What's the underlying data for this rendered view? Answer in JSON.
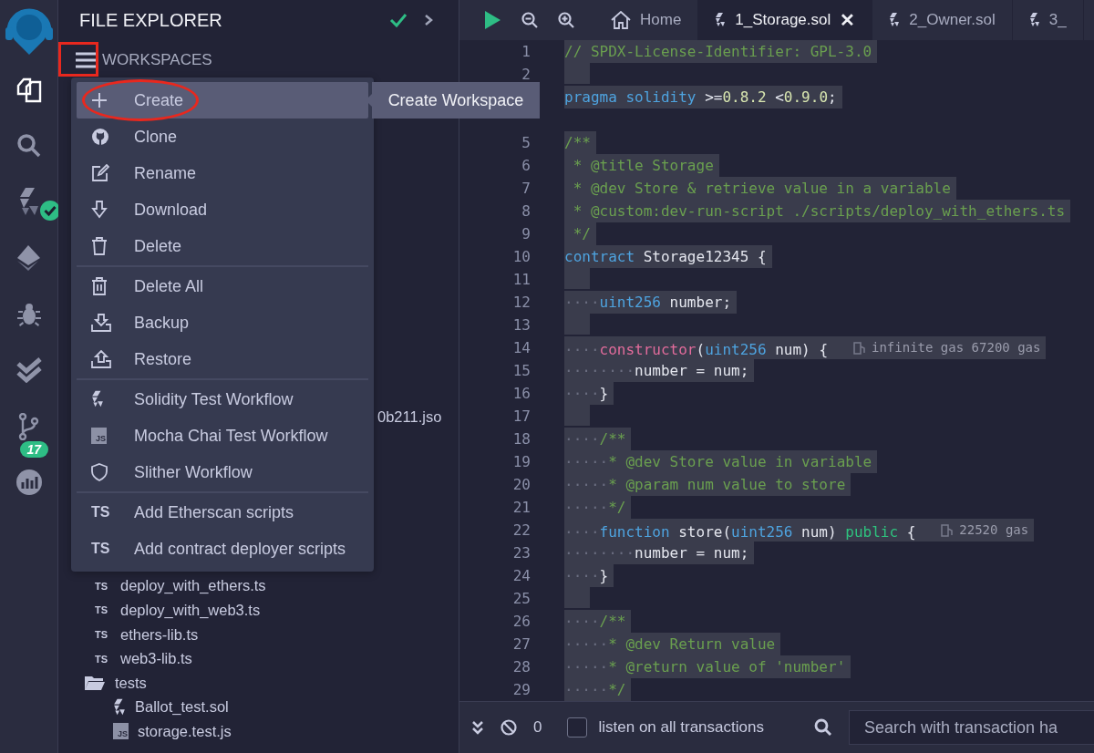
{
  "sidebar": {
    "items": [
      {
        "kind": "logo",
        "selected": false
      },
      {
        "kind": "files",
        "selected": true
      },
      {
        "kind": "search",
        "selected": false
      },
      {
        "kind": "compiler",
        "selected": false,
        "compiled": true
      },
      {
        "kind": "deploy",
        "selected": false
      },
      {
        "kind": "debug",
        "selected": false
      },
      {
        "kind": "test",
        "selected": false
      },
      {
        "kind": "git",
        "selected": false,
        "badge": "17"
      },
      {
        "kind": "analytics",
        "selected": false
      }
    ]
  },
  "explorer": {
    "title": "FILE EXPLORER",
    "section": "WORKSPACES",
    "tree": [
      {
        "name": "0b211.jso",
        "kind": "fragment"
      },
      {
        "name": "deploy_with_ethers.ts",
        "kind": "ts",
        "icon_label": "TS"
      },
      {
        "name": "deploy_with_web3.ts",
        "kind": "ts",
        "icon_label": "TS"
      },
      {
        "name": "ethers-lib.ts",
        "kind": "ts",
        "icon_label": "TS"
      },
      {
        "name": "web3-lib.ts",
        "kind": "ts",
        "icon_label": "TS"
      },
      {
        "name": "tests",
        "kind": "folder",
        "children": [
          {
            "name": "Ballot_test.sol",
            "kind": "sol"
          },
          {
            "name": "storage.test.js",
            "kind": "js",
            "icon_label": "JS"
          }
        ]
      }
    ]
  },
  "menu": {
    "groups": [
      [
        {
          "label": "Create",
          "kind": "plus",
          "selected": true
        },
        {
          "label": "Clone",
          "kind": "github",
          "selected": false
        },
        {
          "label": "Rename",
          "kind": "edit",
          "selected": false
        },
        {
          "label": "Download",
          "kind": "download",
          "selected": false
        },
        {
          "label": "Delete",
          "kind": "trash",
          "selected": false
        }
      ],
      [
        {
          "label": "Delete All",
          "kind": "trash-all",
          "selected": false
        },
        {
          "label": "Backup",
          "kind": "backup",
          "selected": false
        },
        {
          "label": "Restore",
          "kind": "restore",
          "selected": false
        }
      ],
      [
        {
          "label": "Solidity Test Workflow",
          "kind": "sol",
          "selected": false
        },
        {
          "label": "Mocha Chai Test Workflow",
          "kind": "js",
          "icon_label": "JS",
          "selected": false
        },
        {
          "label": "Slither Workflow",
          "kind": "shield",
          "selected": false
        }
      ],
      [
        {
          "label": "Add Etherscan scripts",
          "kind": "ts",
          "icon_label": "TS",
          "selected": false
        },
        {
          "label": "Add contract deployer scripts",
          "kind": "ts",
          "icon_label": "TS",
          "selected": false
        }
      ]
    ],
    "tooltip": "Create Workspace"
  },
  "editor": {
    "tabs": [
      {
        "label": "Home",
        "kind": "home",
        "selected": false
      },
      {
        "label": "1_Storage.sol",
        "kind": "sol",
        "selected": true,
        "close": "✕"
      },
      {
        "label": "2_Owner.sol",
        "kind": "sol",
        "selected": false
      },
      {
        "label": "3_",
        "kind": "sol",
        "selected": false
      }
    ],
    "lines": [
      {
        "number": "1",
        "tokens": [
          {
            "t": "// SPDX-License-Identifier: GPL-3.0",
            "kind": "comment"
          }
        ]
      },
      {
        "number": "2"
      },
      {
        "tokens": [
          {
            "t": "pragma",
            "kind": "keyword"
          },
          {
            "t": " solidity",
            "kind": "keyword"
          },
          {
            "t": " >=",
            "kind": "plain"
          },
          {
            "t": "0.8.2",
            "kind": "number"
          },
          {
            "t": " <",
            "kind": "plain"
          },
          {
            "t": "0.9.0",
            "kind": "number"
          },
          {
            "t": ";",
            "kind": "plain"
          }
        ]
      },
      {
        "kind": "blank"
      },
      {
        "number": "5",
        "tokens": [
          {
            "t": "/**",
            "kind": "comment"
          }
        ]
      },
      {
        "number": "6",
        "tokens": [
          {
            "t": " * @title Storage",
            "kind": "comment"
          }
        ]
      },
      {
        "number": "7",
        "tokens": [
          {
            "t": " * @dev Store & retrieve value in a variable",
            "kind": "comment"
          }
        ]
      },
      {
        "number": "8",
        "tokens": [
          {
            "t": " * @custom:dev-run-script ./scripts/deploy_with_ethers.ts",
            "kind": "comment"
          }
        ]
      },
      {
        "number": "9",
        "tokens": [
          {
            "t": " */",
            "kind": "comment"
          }
        ]
      },
      {
        "number": "10",
        "tokens": [
          {
            "t": "contract",
            "kind": "keyword"
          },
          {
            "t": " Storage12345 {",
            "kind": "plain"
          }
        ]
      },
      {
        "number": "11"
      },
      {
        "number": "12",
        "indent": "····",
        "tokens": [
          {
            "t": "uint256",
            "kind": "keyword"
          },
          {
            "t": " number;",
            "kind": "plain"
          }
        ]
      },
      {
        "number": "13"
      },
      {
        "number": "14",
        "indent": "····",
        "tokens": [
          {
            "t": "constructor",
            "kind": "function"
          },
          {
            "t": "(",
            "kind": "plain"
          },
          {
            "t": "uint256",
            "kind": "keyword"
          },
          {
            "t": " num) {",
            "kind": "plain"
          }
        ],
        "gas": "infinite gas 67200 gas"
      },
      {
        "number": "15",
        "indent": "········",
        "tokens": [
          {
            "t": "number = num;",
            "kind": "plain"
          }
        ]
      },
      {
        "number": "16",
        "indent": "····",
        "tokens": [
          {
            "t": "}",
            "kind": "plain"
          }
        ]
      },
      {
        "number": "17"
      },
      {
        "number": "18",
        "indent": "····",
        "tokens": [
          {
            "t": "/**",
            "kind": "comment"
          }
        ]
      },
      {
        "number": "19",
        "indent": "·····",
        "tokens": [
          {
            "t": "* @dev Store value in variable",
            "kind": "comment"
          }
        ]
      },
      {
        "number": "20",
        "indent": "·····",
        "tokens": [
          {
            "t": "* @param num value to store",
            "kind": "comment"
          }
        ]
      },
      {
        "number": "21",
        "indent": "·····",
        "tokens": [
          {
            "t": "*/",
            "kind": "comment"
          }
        ]
      },
      {
        "number": "22",
        "indent": "····",
        "tokens": [
          {
            "t": "function",
            "kind": "keyword"
          },
          {
            "t": " store(",
            "kind": "plain"
          },
          {
            "t": "uint256",
            "kind": "keyword"
          },
          {
            "t": " num) ",
            "kind": "plain"
          },
          {
            "t": "public",
            "kind": "modifier"
          },
          {
            "t": " {",
            "kind": "plain"
          }
        ],
        "gas": "22520 gas"
      },
      {
        "number": "23",
        "indent": "········",
        "tokens": [
          {
            "t": "number = num;",
            "kind": "plain"
          }
        ]
      },
      {
        "number": "24",
        "indent": "····",
        "tokens": [
          {
            "t": "}",
            "kind": "plain"
          }
        ]
      },
      {
        "number": "25"
      },
      {
        "number": "26",
        "indent": "····",
        "tokens": [
          {
            "t": "/**",
            "kind": "comment"
          }
        ]
      },
      {
        "number": "27",
        "indent": "·····",
        "tokens": [
          {
            "t": "* @dev Return value",
            "kind": "comment"
          }
        ]
      },
      {
        "number": "28",
        "indent": "·····",
        "tokens": [
          {
            "t": "* @return value of 'number'",
            "kind": "comment"
          }
        ]
      },
      {
        "number": "29",
        "indent": "·····",
        "tokens": [
          {
            "t": "*/",
            "kind": "comment"
          }
        ]
      }
    ]
  },
  "terminal": {
    "count": "0",
    "listen": {
      "label": "listen on all transactions",
      "checked": false
    },
    "search": {
      "placeholder": "Search with transaction ha"
    }
  }
}
